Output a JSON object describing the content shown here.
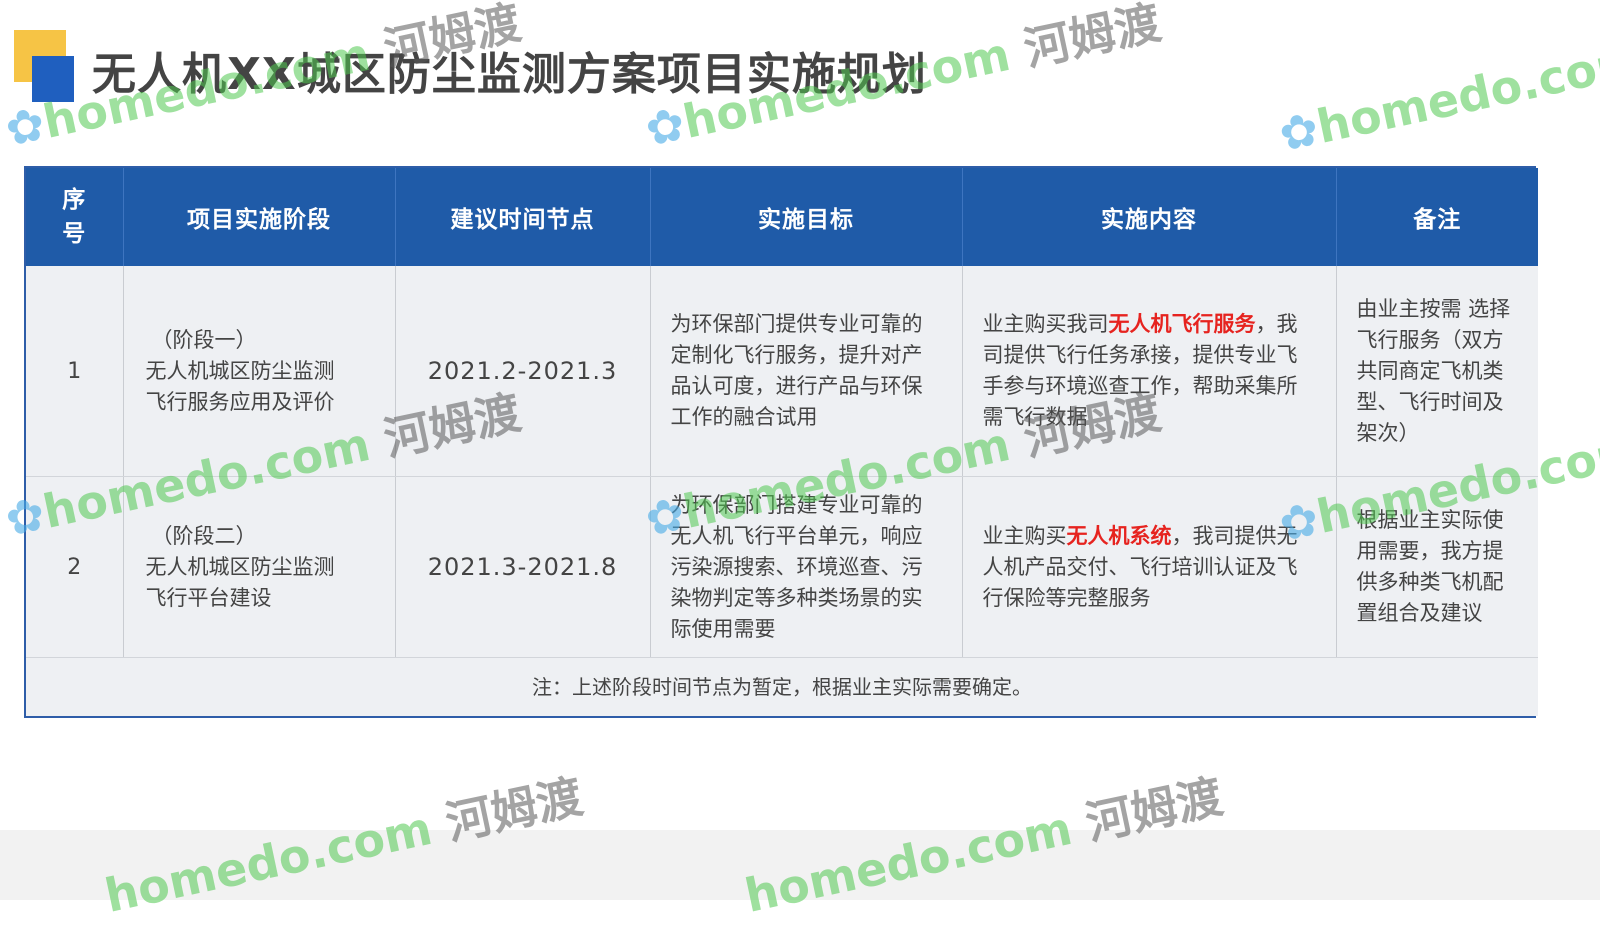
{
  "title": "无人机XX城区防尘监测方案项目实施规划",
  "table": {
    "headers": [
      "序号",
      "项目实施阶段",
      "建议时间节点",
      "实施目标",
      "实施内容",
      "备注"
    ],
    "rows": [
      {
        "index": "1",
        "stage_line1": "（阶段一）",
        "stage_line2": "无人机城区防尘监测",
        "stage_line3": "飞行服务应用及评价",
        "time": "2021.2-2021.3",
        "goal": "为环保部门提供专业可靠的定制化飞行服务，提升对产品认可度，进行产品与环保工作的融合试用",
        "content_pre": "业主购买我司",
        "content_highlight": "无人机飞行服务",
        "content_post": "，我司提供飞行任务承接，提供专业飞手参与环境巡查工作，帮助采集所需飞行数据",
        "note": "由业主按需 选择飞行服务（双方共同商定飞机类型、飞行时间及架次）"
      },
      {
        "index": "2",
        "stage_line1": "（阶段二）",
        "stage_line2": "无人机城区防尘监测",
        "stage_line3": "飞行平台建设",
        "time": "2021.3-2021.8",
        "goal": "为环保部门搭建专业可靠的无人机飞行平台单元，响应污染源搜索、环境巡查、污染物判定等多种类场景的实际使用需要",
        "content_pre": "业主购买",
        "content_highlight": "无人机系统",
        "content_post": "，我司提供无人机产品交付、飞行培训认证及飞行保险等完整服务",
        "note": "根据业主实际使用需要，我方提供多种类飞机配置组合及建议"
      }
    ],
    "footnote": "注：上述阶段时间节点为暂定，根据业主实际需要确定。"
  },
  "watermark": {
    "latin": "homedo.com",
    "cn": "河姆渡"
  },
  "colors": {
    "header_bg": "#1f5ba8",
    "highlight": "#e6231f",
    "accent_yellow": "#f6c445",
    "accent_blue": "#1f5fbf"
  }
}
